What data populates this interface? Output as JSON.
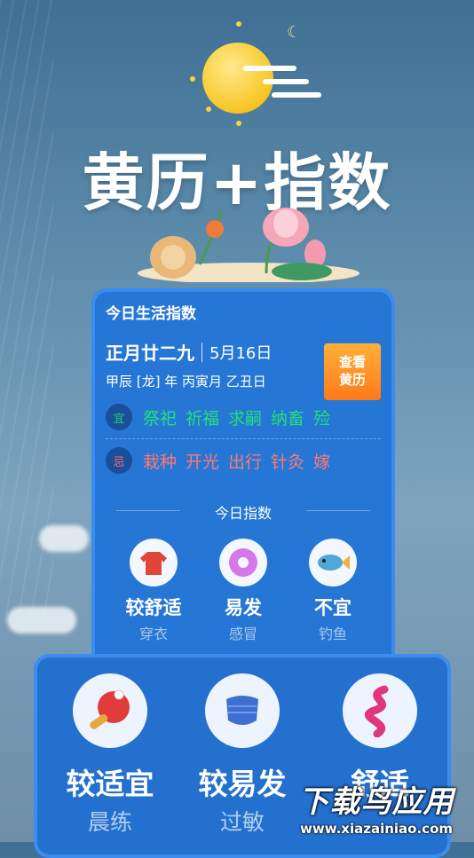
{
  "hero": {
    "title": "黄历+指数"
  },
  "card": {
    "heading": "今日生活指数",
    "lunar_date": "正月廿二九",
    "solar_date": "5月16日",
    "ganzhi": "甲辰 [龙] 年  丙寅月 乙丑日",
    "check_button": "查看黄历",
    "yi": {
      "badge": "宜",
      "items": [
        "祭祀",
        "祈福",
        "求嗣",
        "纳畜",
        "殓"
      ]
    },
    "ji": {
      "badge": "忌",
      "items": [
        "栽种",
        "开光",
        "出行",
        "针灸",
        "嫁"
      ]
    },
    "index_title": "今日指数",
    "indices": [
      {
        "value": "较舒适",
        "name": "穿衣",
        "icon": "sweater-icon"
      },
      {
        "value": "易发",
        "name": "感冒",
        "icon": "donut-icon"
      },
      {
        "value": "不宜",
        "name": "钓鱼",
        "icon": "fish-icon"
      }
    ]
  },
  "panel": {
    "indices": [
      {
        "value": "较适宜",
        "name": "晨练",
        "icon": "ping-pong-icon"
      },
      {
        "value": "较易发",
        "name": "过敏",
        "icon": "mask-icon"
      },
      {
        "value": "舒适",
        "name": "",
        "icon": "ribbon-icon"
      }
    ]
  },
  "watermark": {
    "main": "下载鸟应用",
    "url": "www.xiazainiao.com"
  },
  "colors": {
    "card_bg": "#2676d6",
    "yi": "#22e079",
    "ji": "#ff7b6b",
    "check_button": "#ff8a20"
  }
}
